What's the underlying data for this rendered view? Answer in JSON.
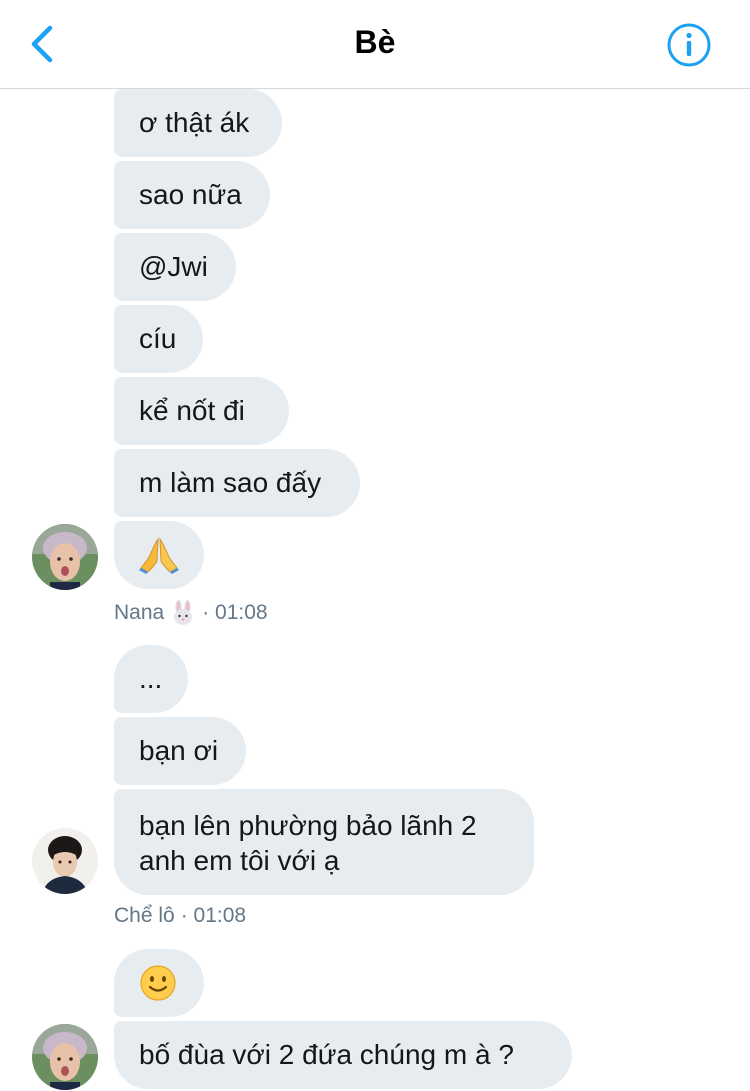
{
  "header": {
    "back_icon": "chevron-left-icon",
    "title": "Bè",
    "info_icon": "info-icon",
    "accent_color": "#1da1f2"
  },
  "messages": [
    {
      "text": "ơ thật ák"
    },
    {
      "text": "sao nữa"
    },
    {
      "text": "@Jwi"
    },
    {
      "text": "cíu"
    },
    {
      "text": "kể nốt đi"
    },
    {
      "text": "m làm sao đấy"
    },
    {
      "text": "🙏",
      "emoji": "folded-hands-icon"
    }
  ],
  "group1_meta": {
    "name": "Nana",
    "name_emoji": "rabbit-face-icon",
    "time": "· 01:08"
  },
  "messages2": [
    {
      "text": "..."
    },
    {
      "text": "bạn ơi"
    },
    {
      "text": "bạn lên phường bảo lãnh 2 anh em tôi với ạ"
    }
  ],
  "group2_meta": {
    "name": "Chể lô",
    "time": "· 01:08"
  },
  "messages3": [
    {
      "text": "🙂",
      "emoji": "slightly-smiling-face-icon"
    },
    {
      "text": "bố đùa với 2 đứa chúng m à ?"
    }
  ],
  "colors": {
    "bubble": "#e6ecf0",
    "meta_text": "#657786"
  }
}
